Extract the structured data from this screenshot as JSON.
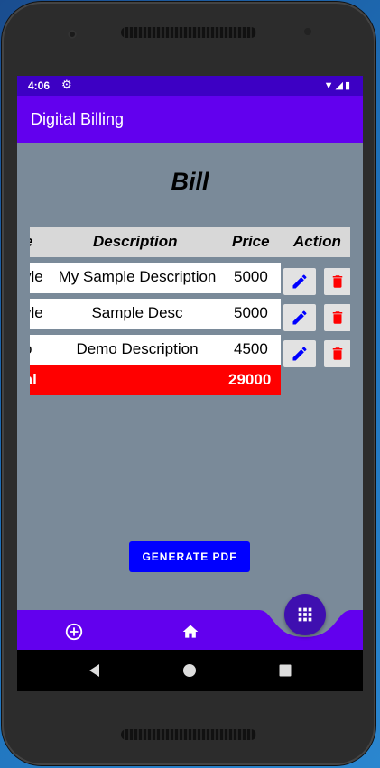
{
  "status": {
    "time": "4:06"
  },
  "appbar": {
    "title": "Digital Billing"
  },
  "bill": {
    "title": "Bill"
  },
  "table": {
    "headers": {
      "name": "e",
      "description": "Description",
      "price": "Price",
      "action": "Action"
    },
    "rows": [
      {
        "name": "yle",
        "description": "My Sample Description",
        "price": "5000"
      },
      {
        "name": "yle",
        "description": "Sample Desc",
        "price": "5000"
      },
      {
        "name": "o",
        "description": "Demo Description",
        "price": "4500"
      }
    ],
    "total": {
      "label": "tal",
      "value": "29000"
    }
  },
  "buttons": {
    "generate_pdf": "GENERATE PDF"
  },
  "colors": {
    "app_bar": "#6200ee",
    "status_bar": "#3d00c4",
    "content_bg": "#7a8a99",
    "total_row": "#ff0000",
    "edit_icon": "#0000ff",
    "delete_icon": "#ff0000",
    "generate_button": "#0000ff",
    "fab": "#3f0fb0"
  },
  "icons": {
    "status": [
      "gear-icon",
      "wifi-icon",
      "signal-icon",
      "battery-icon"
    ],
    "row_actions": [
      "edit-icon",
      "delete-icon"
    ],
    "bottom_nav": [
      "add-circle-icon",
      "home-icon"
    ],
    "fab": "grid-icon",
    "system_nav": [
      "back-icon",
      "home-circle-icon",
      "recents-icon"
    ]
  }
}
